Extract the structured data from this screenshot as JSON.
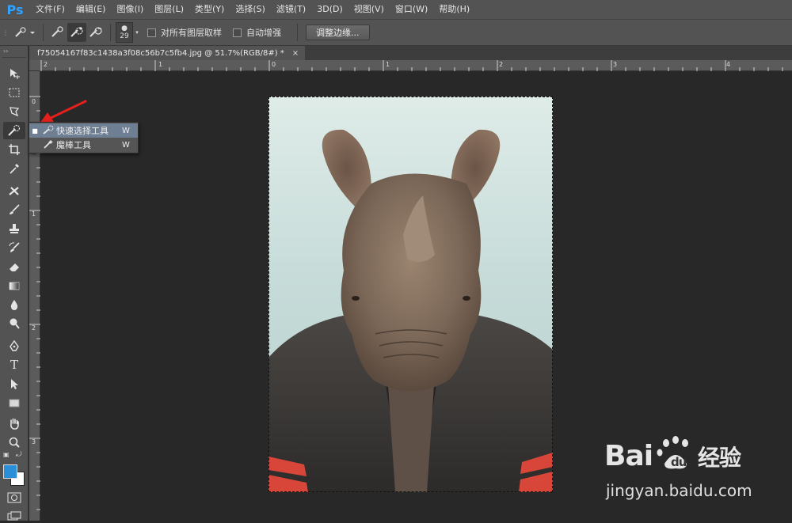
{
  "app": {
    "logo": "Ps"
  },
  "menu": [
    "文件(F)",
    "编辑(E)",
    "图像(I)",
    "图层(L)",
    "类型(Y)",
    "选择(S)",
    "滤镜(T)",
    "3D(D)",
    "视图(V)",
    "窗口(W)",
    "帮助(H)"
  ],
  "options": {
    "brush_size": "29",
    "sample_all_layers_label": "对所有图层取样",
    "auto_enhance_label": "自动增强",
    "refine_edge_label": "调整边缘..."
  },
  "document": {
    "tab_title": "f75054167f83c1438a3f08c56b7c5fb4.jpg @ 51.7%(RGB/8#) *",
    "close_glyph": "×"
  },
  "ruler_top_labels": [
    "2",
    "1",
    "0",
    "1",
    "2",
    "3",
    "4"
  ],
  "ruler_left_labels": [
    "0",
    "1",
    "2",
    "3"
  ],
  "flyout": [
    {
      "label": "快速选择工具",
      "shortcut": "W",
      "selected": true
    },
    {
      "label": "魔棒工具",
      "shortcut": "W",
      "selected": false
    }
  ],
  "tools": [
    "move-tool",
    "marquee-tool",
    "lasso-tool",
    "quick-selection-tool",
    "crop-tool",
    "eyedropper-tool",
    "healing-brush-tool",
    "brush-tool",
    "clone-stamp-tool",
    "history-brush-tool",
    "eraser-tool",
    "gradient-tool",
    "blur-tool",
    "dodge-tool",
    "pen-tool",
    "type-tool",
    "path-selection-tool",
    "rectangle-tool",
    "hand-tool",
    "zoom-tool"
  ],
  "colors": {
    "foreground": "#2a8fd6",
    "background": "#ffffff",
    "accent": "#2fa3ff"
  },
  "watermark": {
    "logo": "Bai du 经验",
    "url": "jingyan.baidu.com"
  }
}
